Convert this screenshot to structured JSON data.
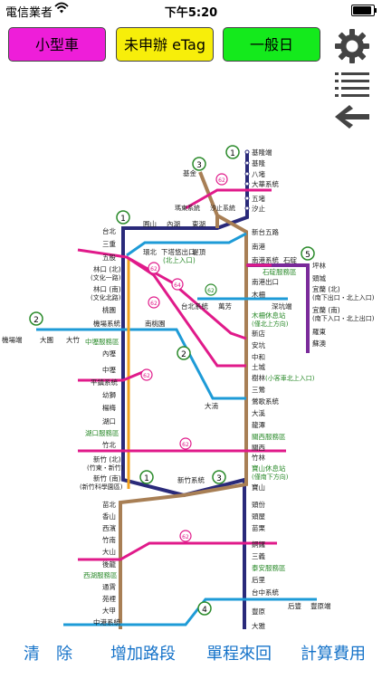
{
  "status_bar": {
    "carrier": "電信業者",
    "time": "下午5:20"
  },
  "mode_buttons": {
    "vehicle": "小型車",
    "etag": "未申辦 eTag",
    "day": "一般日"
  },
  "icons": {
    "settings": "gear-icon",
    "list": "list-icon",
    "back": "back-arrow-icon"
  },
  "colors": {
    "accent": "#1673c9",
    "magenta": "#ee1ed9",
    "yellow": "#f7ee0a",
    "green": "#14ea1c"
  },
  "map": {
    "route_markers": [
      "1",
      "3",
      "3",
      "1",
      "5",
      "2",
      "2",
      "1",
      "1",
      "3",
      "4"
    ],
    "ramp_badges": [
      "62",
      "62",
      "64",
      "62",
      "62",
      "62",
      "62",
      "62",
      "62"
    ],
    "stations": {
      "jilong_end": "基隆端",
      "jilong": "基隆",
      "badu": "八堵",
      "dahua": "大華系統",
      "wudu": "五堵",
      "xizhi": "汐止",
      "xizhi_sys": "汐止系統",
      "jijin": "基金",
      "duandong": "瑪東系統",
      "xinwugu": "新台五路",
      "nangang": "南港",
      "yuanshan": "圓山",
      "neihu": "內湖",
      "donghu": "東湖",
      "taibei": "台北",
      "sanchong": "三重",
      "wugu": "五股",
      "dingtou": "堤頂",
      "huanbei": "環北",
      "xiaxi": "下塔悠出口",
      "beishang": "(北上入口)",
      "linkou_n": "林口 (北)",
      "wenhua1": "(文化一路)",
      "linkou_s": "林口 (南)",
      "wenbei": "(文化北路)",
      "taoyuan": "桃園",
      "jichang": "機場系統",
      "zhongli_sa": "中壢服務區",
      "neili": "內壢",
      "zhongli": "中壢",
      "pingzhen": "平鎮系統",
      "youshi": "幼獅",
      "yangmei": "楊梅",
      "hukou": "湖口",
      "hukou_sa": "湖口服務區",
      "zhubei": "竹北",
      "xinzhu_n": "新竹 (北)",
      "zhudong_xinzhu": "(竹東・新竹)",
      "xinzhu_s": "新竹 (南)",
      "kexue": "(新竹科學園區)",
      "nangang_sys": "南港系統",
      "shiding": "石碇",
      "shiding_sa": "石碇服務區",
      "pinglin": "坪林",
      "toucheng": "頭城",
      "yilan_n": "宜蘭 (北)",
      "yilan_n_note": "(南下出口・北上入口)",
      "yilan_s": "宜蘭 (南)",
      "yilan_s_note": "(南下入口・北上出口)",
      "luodong": "羅東",
      "suao": "蘇澳",
      "nangang_exit": "南港出口",
      "muzha": "木柵",
      "shenkeng": "深坑端",
      "taibei_sys": "台北系統",
      "wanfang": "萬芳",
      "muzha_rest": "木柵休息站",
      "muzha_rest_note": "(僅北上方向)",
      "xindian": "新店",
      "ankeng": "安坑",
      "zhonghe": "中和",
      "tucheng": "土城",
      "shulin": "樹林",
      "shulin_note": "(小客車北上入口)",
      "sanying": "三鶯",
      "yingge_sys": "鶯歌系統",
      "daxi": "大溪",
      "longtan": "龍潭",
      "guanxi_sa": "關西服務區",
      "guanxi": "關西",
      "zhulin": "竹林",
      "baoshan_rest": "寶山休息站",
      "baoshan_note": "(僅南下方向)",
      "baoshan": "寶山",
      "qiaotou_end": "機場端",
      "dayuan": "大園",
      "dazhu": "大竹",
      "nantaoyuan": "南桃園",
      "daxi_w": "大湳",
      "xinzhu_sys": "新竹系統",
      "toufen": "頭份",
      "touwu": "頭屋",
      "miaoli": "苗栗",
      "tongluo": "銅鑼",
      "sanyi": "三義",
      "taian_sa": "泰安服務區",
      "houli": "后里",
      "taizhong_sys": "台中系統",
      "houfeng": "后豐",
      "fengyuan_end": "豐原端",
      "fengyuan": "豐原",
      "daya": "大雅",
      "zhunan": "苗北",
      "xianshan": "香山",
      "xibin": "西濱",
      "zhunan2": "竹南",
      "dashan": "大山",
      "houlong": "後龍",
      "xihu_sa": "西湖服務區",
      "tongxiao": "通霄",
      "yuanli": "苑裡",
      "dajia": "大甲",
      "zhonggang": "中港系統"
    }
  },
  "toolbar": {
    "clear": "清　除",
    "add_route": "增加路段",
    "round_trip": "單程來回",
    "calculate": "計算費用"
  }
}
